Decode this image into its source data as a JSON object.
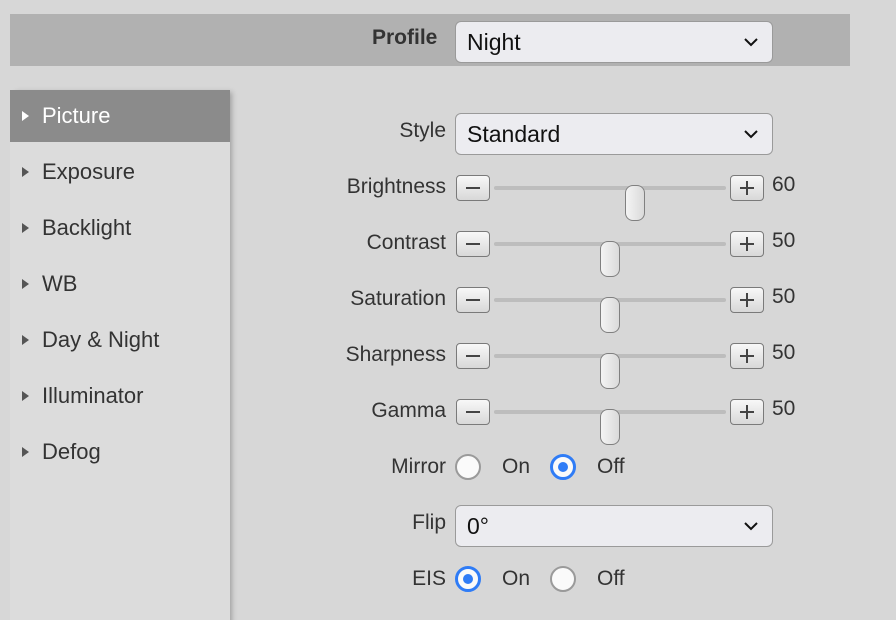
{
  "profile": {
    "label": "Profile",
    "value": "Night"
  },
  "sidebar": {
    "items": [
      {
        "label": "Picture",
        "active": true
      },
      {
        "label": "Exposure"
      },
      {
        "label": "Backlight"
      },
      {
        "label": "WB"
      },
      {
        "label": "Day & Night"
      },
      {
        "label": "Illuminator"
      },
      {
        "label": "Defog"
      }
    ]
  },
  "style": {
    "label": "Style",
    "value": "Standard"
  },
  "sliders": [
    {
      "label": "Brightness",
      "value": "60",
      "level": 60
    },
    {
      "label": "Contrast",
      "value": "50",
      "level": 50
    },
    {
      "label": "Saturation",
      "value": "50",
      "level": 50
    },
    {
      "label": "Sharpness",
      "value": "50",
      "level": 50
    },
    {
      "label": "Gamma",
      "value": "50",
      "level": 50
    }
  ],
  "mirror": {
    "label": "Mirror",
    "on": "On",
    "off": "Off",
    "selected": "off"
  },
  "flip": {
    "label": "Flip",
    "value": "0°"
  },
  "eis": {
    "label": "EIS",
    "on": "On",
    "off": "Off",
    "selected": "on"
  },
  "colors": {
    "accent": "#2f7cf6",
    "active_nav": "#8b8b8b",
    "header_bar": "#b1b1b1"
  }
}
